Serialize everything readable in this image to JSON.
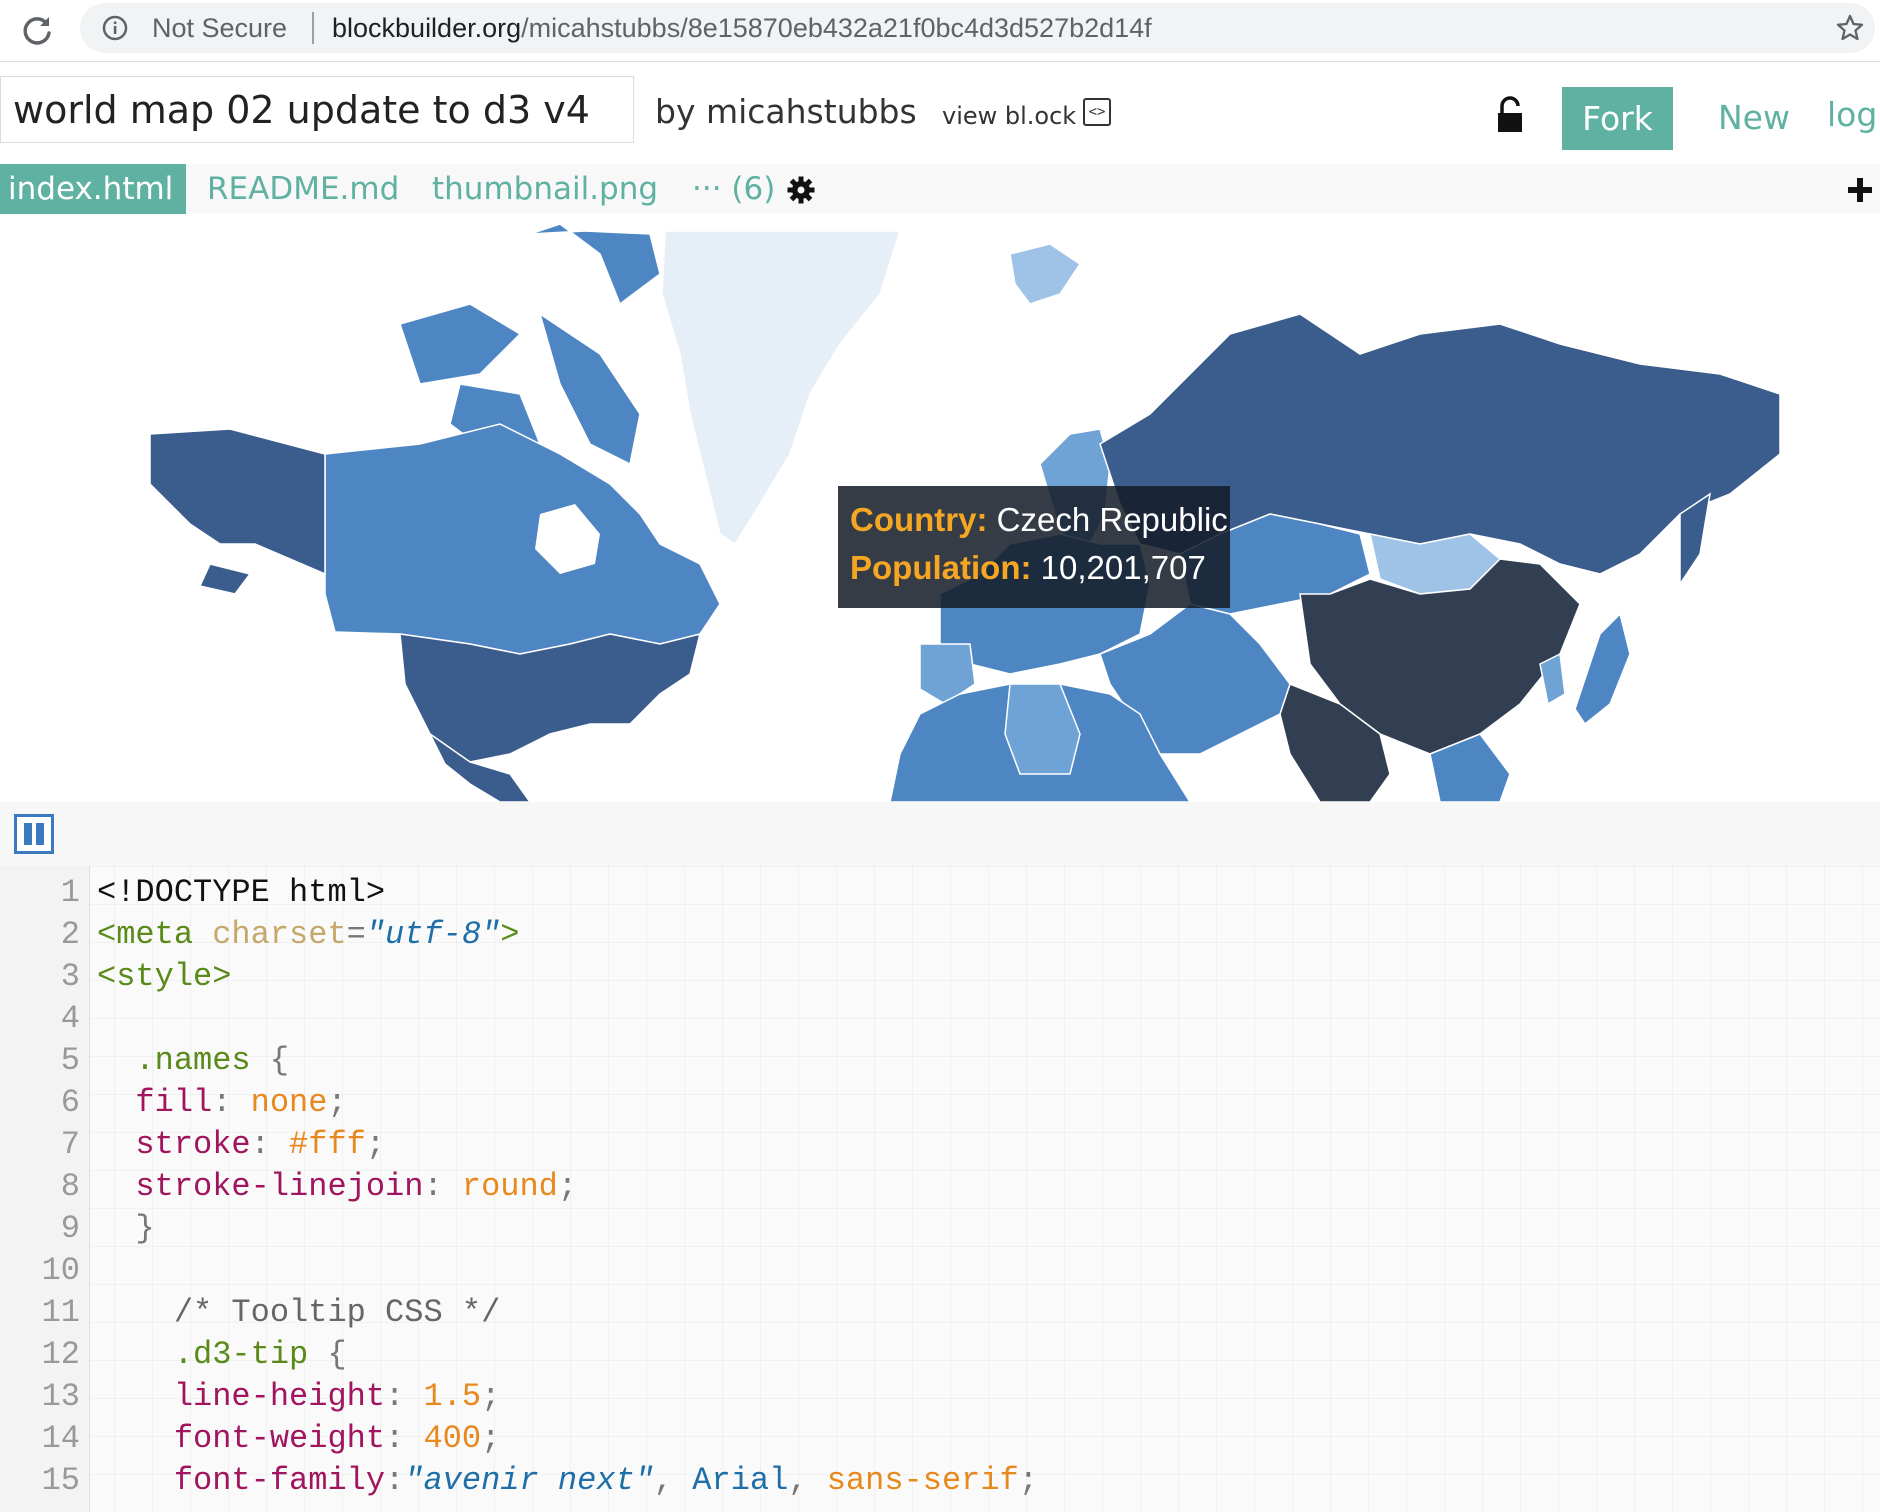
{
  "browser": {
    "security_label": "Not Secure",
    "url_host": "blockbuilder.org",
    "url_path": "/micahstubbs/8e15870eb432a21f0bc4d3d527b2d14f"
  },
  "header": {
    "title": "world map 02 update to d3 v4",
    "author": "by micahstubbs",
    "view_block": "view bl.ock",
    "fork_label": "Fork",
    "new_label": "New",
    "login_label": "logi"
  },
  "tabs": [
    {
      "label": "index.html",
      "active": true
    },
    {
      "label": "README.md"
    },
    {
      "label": "thumbnail.png"
    },
    {
      "label": "··· (6)"
    }
  ],
  "map": {
    "tooltip": {
      "country_key": "Country:",
      "country_value": "Czech Republic",
      "population_key": "Population:",
      "population_value": "10,201,707"
    },
    "colors": {
      "lightest": "#e6eef7",
      "light": "#9ec3e6",
      "medium_light": "#6fa3d6",
      "medium": "#4e86c4",
      "dark": "#3b5d8d",
      "darkest": "#323e52"
    }
  },
  "code_lines": [
    {
      "n": "1",
      "tokens": [
        [
          "t-plain",
          "<!DOCTYPE html>"
        ]
      ]
    },
    {
      "n": "2",
      "tokens": [
        [
          "t-tag",
          "<meta "
        ],
        [
          "t-attr",
          "charset"
        ],
        [
          "t-punct",
          "="
        ],
        [
          "t-string",
          "\"utf-8\""
        ],
        [
          "t-tag",
          ">"
        ]
      ]
    },
    {
      "n": "3",
      "tokens": [
        [
          "t-tag",
          "<style>"
        ]
      ]
    },
    {
      "n": "4",
      "tokens": []
    },
    {
      "n": "5",
      "tokens": [
        [
          "t-plain",
          "  "
        ],
        [
          "t-selector",
          ".names"
        ],
        [
          "t-punct",
          " {"
        ]
      ]
    },
    {
      "n": "6",
      "tokens": [
        [
          "t-plain",
          "  "
        ],
        [
          "t-prop",
          "fill"
        ],
        [
          "t-punct",
          ": "
        ],
        [
          "t-val",
          "none"
        ],
        [
          "t-punct",
          ";"
        ]
      ]
    },
    {
      "n": "7",
      "tokens": [
        [
          "t-plain",
          "  "
        ],
        [
          "t-prop",
          "stroke"
        ],
        [
          "t-punct",
          ": "
        ],
        [
          "t-val",
          "#fff"
        ],
        [
          "t-punct",
          ";"
        ]
      ]
    },
    {
      "n": "8",
      "tokens": [
        [
          "t-plain",
          "  "
        ],
        [
          "t-prop",
          "stroke-linejoin"
        ],
        [
          "t-punct",
          ": "
        ],
        [
          "t-val",
          "round"
        ],
        [
          "t-punct",
          ";"
        ]
      ]
    },
    {
      "n": "9",
      "tokens": [
        [
          "t-plain",
          "  "
        ],
        [
          "t-punct",
          "}"
        ]
      ]
    },
    {
      "n": "10",
      "tokens": []
    },
    {
      "n": "11",
      "tokens": [
        [
          "t-plain",
          "    "
        ],
        [
          "t-comment",
          "/* Tooltip CSS */"
        ]
      ]
    },
    {
      "n": "12",
      "tokens": [
        [
          "t-plain",
          "    "
        ],
        [
          "t-selector",
          ".d3-tip"
        ],
        [
          "t-punct",
          " {"
        ]
      ]
    },
    {
      "n": "13",
      "tokens": [
        [
          "t-plain",
          "    "
        ],
        [
          "t-prop",
          "line-height"
        ],
        [
          "t-punct",
          ": "
        ],
        [
          "t-num",
          "1.5"
        ],
        [
          "t-punct",
          ";"
        ]
      ]
    },
    {
      "n": "14",
      "tokens": [
        [
          "t-plain",
          "    "
        ],
        [
          "t-prop",
          "font-weight"
        ],
        [
          "t-punct",
          ": "
        ],
        [
          "t-num",
          "400"
        ],
        [
          "t-punct",
          ";"
        ]
      ]
    },
    {
      "n": "15",
      "tokens": [
        [
          "t-plain",
          "    "
        ],
        [
          "t-prop",
          "font-family"
        ],
        [
          "t-punct",
          ":"
        ],
        [
          "t-string",
          "\"avenir next\""
        ],
        [
          "t-punct",
          ", "
        ],
        [
          "t-kw",
          "Arial"
        ],
        [
          "t-punct",
          ", "
        ],
        [
          "t-val",
          "sans-serif"
        ],
        [
          "t-punct",
          ";"
        ]
      ]
    }
  ]
}
